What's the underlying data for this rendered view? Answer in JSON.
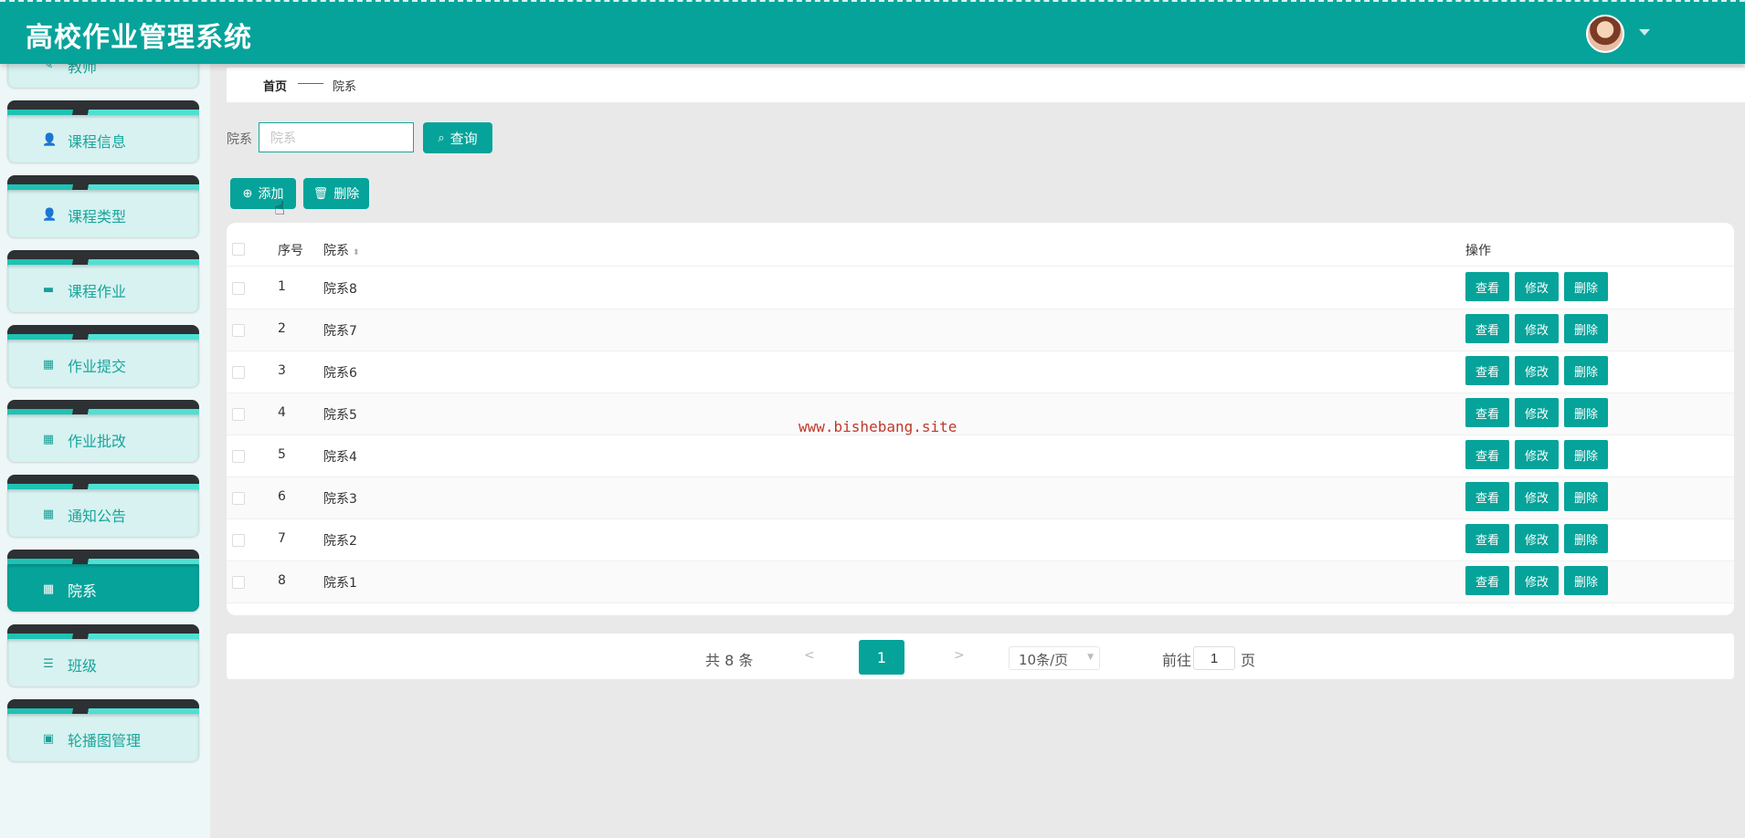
{
  "app": {
    "title": "高校作业管理系统"
  },
  "sidebar": {
    "items": [
      {
        "label": "教师",
        "icon": "user-icon",
        "glyph": "✎"
      },
      {
        "label": "课程信息",
        "icon": "user-icon",
        "glyph": "👤"
      },
      {
        "label": "课程类型",
        "icon": "user-icon",
        "glyph": "👤"
      },
      {
        "label": "课程作业",
        "icon": "monitor-icon",
        "glyph": "▬"
      },
      {
        "label": "作业提交",
        "icon": "grid-icon",
        "glyph": "▦"
      },
      {
        "label": "作业批改",
        "icon": "grid-icon",
        "glyph": "▦"
      },
      {
        "label": "通知公告",
        "icon": "grid-icon",
        "glyph": "▦"
      },
      {
        "label": "院系",
        "icon": "grid-icon",
        "glyph": "▦",
        "active": true
      },
      {
        "label": "班级",
        "icon": "list-icon",
        "glyph": "☰"
      },
      {
        "label": "轮播图管理",
        "icon": "clipboard-icon",
        "glyph": "▣"
      }
    ]
  },
  "breadcrumb": {
    "home": "首页",
    "current": "院系"
  },
  "search": {
    "label": "院系",
    "placeholder": "院系",
    "value": "",
    "button": "查询"
  },
  "actions": {
    "add": "添加",
    "delete": "删除"
  },
  "table": {
    "headers": {
      "index": "序号",
      "name": "院系",
      "ops": "操作"
    },
    "rows": [
      {
        "index": "1",
        "name": "院系8"
      },
      {
        "index": "2",
        "name": "院系7"
      },
      {
        "index": "3",
        "name": "院系6"
      },
      {
        "index": "4",
        "name": "院系5"
      },
      {
        "index": "5",
        "name": "院系4"
      },
      {
        "index": "6",
        "name": "院系3"
      },
      {
        "index": "7",
        "name": "院系2"
      },
      {
        "index": "8",
        "name": "院系1"
      }
    ],
    "row_ops": {
      "view": "查看",
      "edit": "修改",
      "delete": "删除"
    }
  },
  "watermark": "www.bishebang.site",
  "pagination": {
    "total": "共 8 条",
    "prev": "<",
    "current": "1",
    "next": ">",
    "page_size": "10条/页",
    "goto_prefix": "前往",
    "goto_value": "1",
    "goto_suffix": "页"
  },
  "colors": {
    "primary": "#06a39a",
    "sidebar_bg": "#eef7f7",
    "card": "#d7f2f1"
  }
}
